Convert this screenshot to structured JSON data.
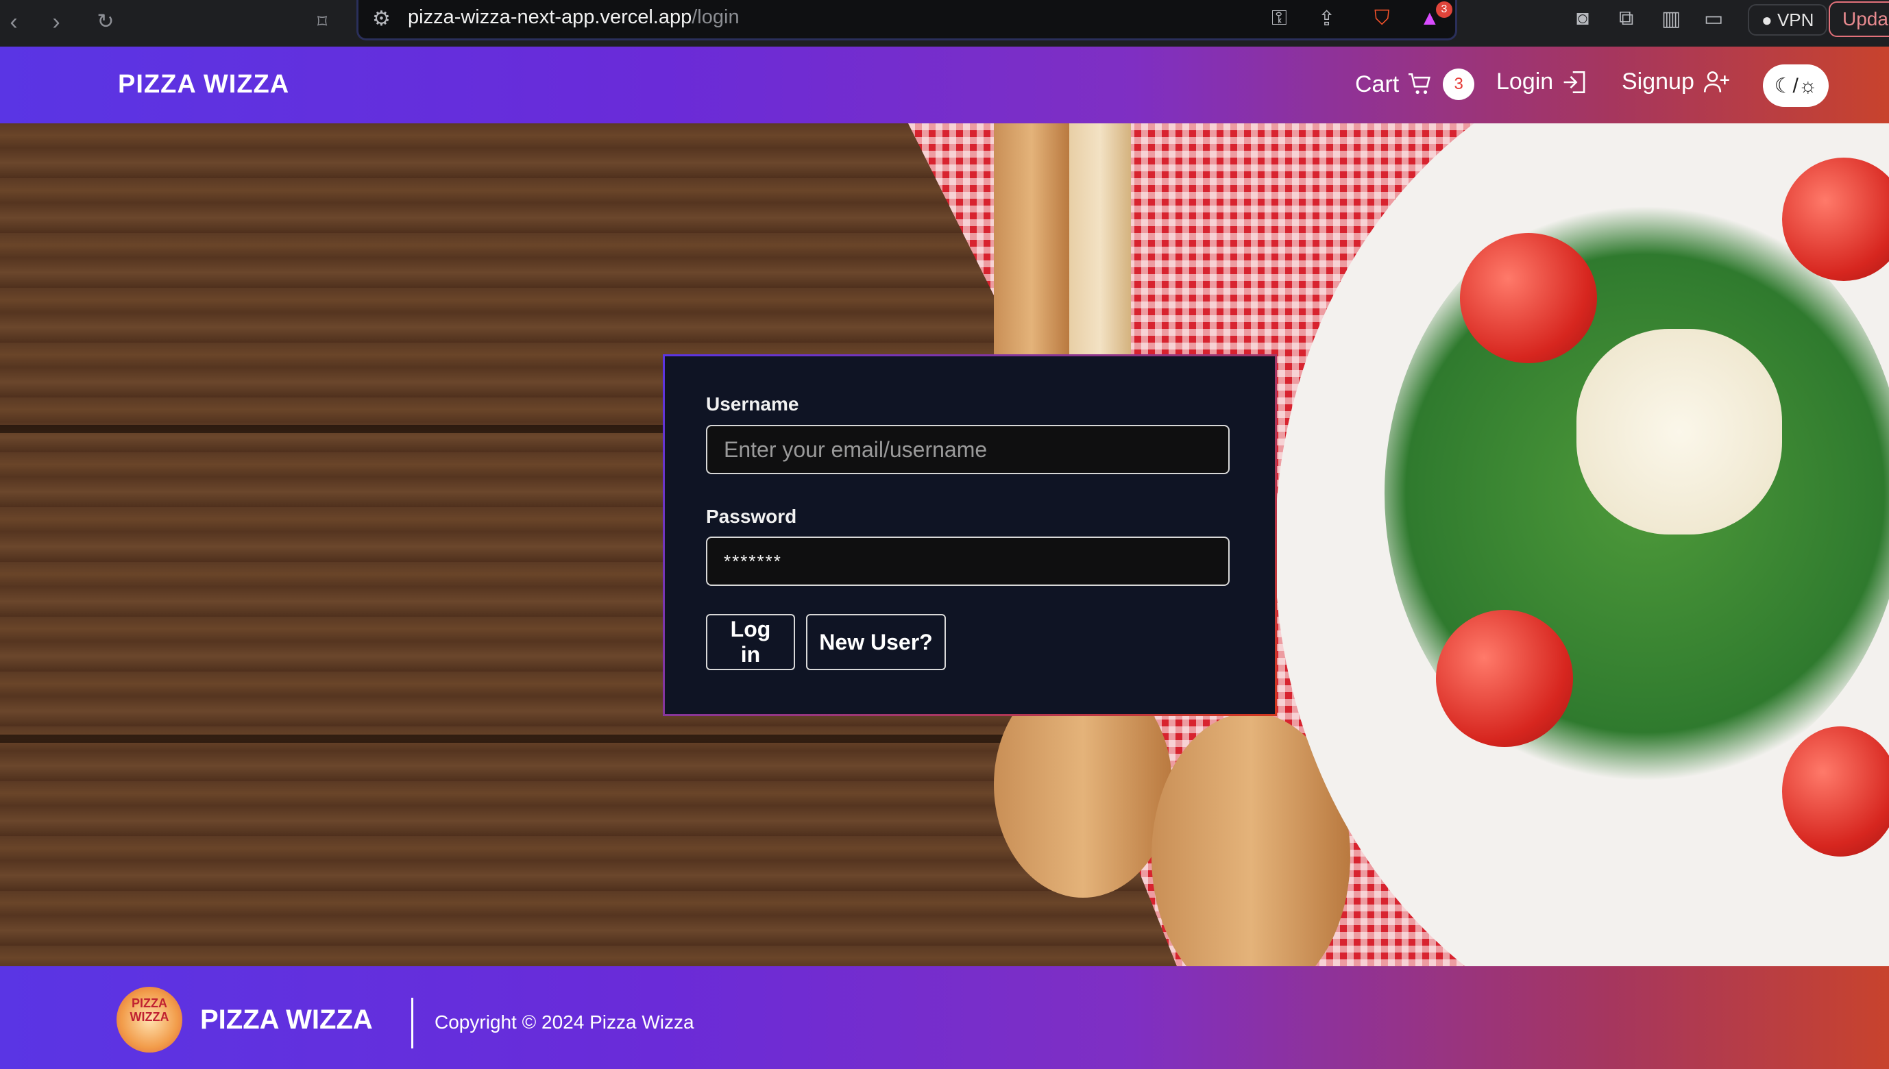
{
  "browser": {
    "url_host": "pizza-wizza-next-app.vercel.app",
    "url_path": "/login",
    "vpn_label": "VPN",
    "update_label": "Upda",
    "extension_badge": "3"
  },
  "header": {
    "brand": "PIZZA WIZZA",
    "cart_label": "Cart",
    "cart_count": "3",
    "login_label": "Login",
    "signup_label": "Signup",
    "theme_toggle_glyph": "☾/☼"
  },
  "login_form": {
    "username_label": "Username",
    "username_placeholder": "Enter your email/username",
    "password_label": "Password",
    "password_value": "*******",
    "login_button": "Log in",
    "new_user_button": "New User?"
  },
  "footer": {
    "logo_text": "PIZZA WIZZA",
    "brand": "PIZZA WIZZA",
    "copyright": "Copyright © 2024 Pizza Wizza"
  }
}
